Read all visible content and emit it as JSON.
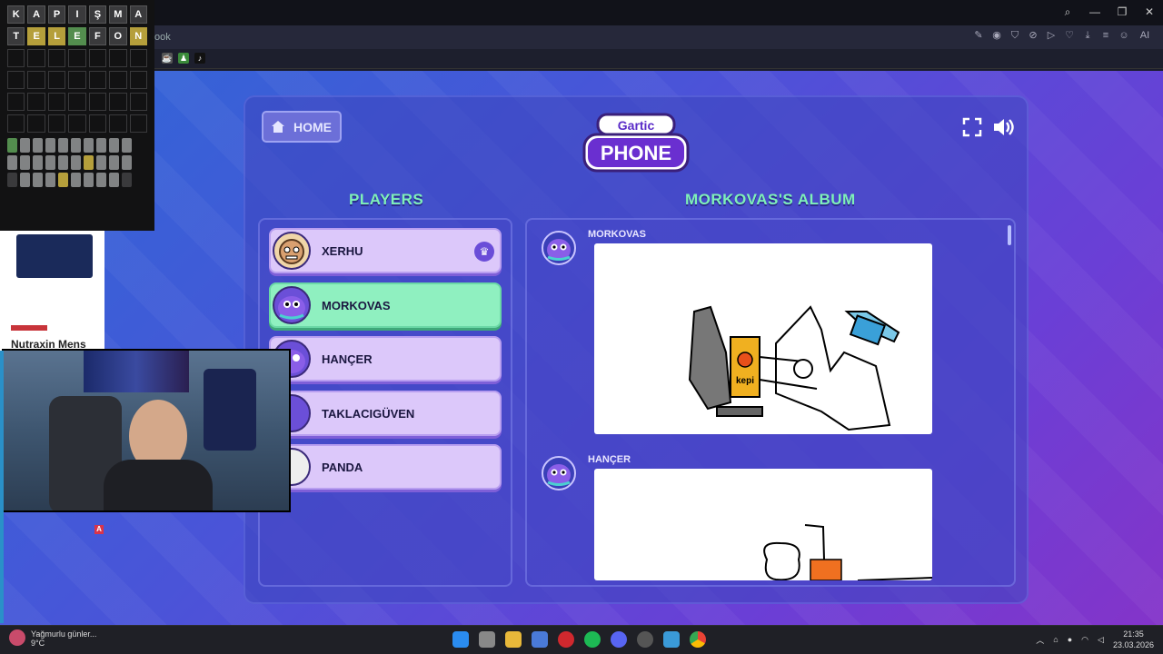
{
  "browser": {
    "address_fragment": "ook",
    "window_controls": [
      "search-icon",
      "minimize-icon",
      "restore-icon",
      "close-icon"
    ],
    "toolbar_right_label": "AI"
  },
  "game": {
    "home_label": "HOME",
    "logo_top": "Gartic",
    "logo_bottom": "PHONE",
    "players_title": "PLAYERS",
    "album_title": "MORKOVAS'S ALBUM",
    "players": [
      {
        "name": "XERHU",
        "host": true,
        "active": false
      },
      {
        "name": "MORKOVAS",
        "host": false,
        "active": true
      },
      {
        "name": "HANÇER",
        "host": false,
        "active": false
      },
      {
        "name": "TAKLACIGÜVEN",
        "host": false,
        "active": false
      },
      {
        "name": "PANDA",
        "host": false,
        "active": false
      }
    ],
    "album": [
      {
        "author": "MORKOVAS"
      },
      {
        "author": "HANÇER"
      }
    ],
    "drawing_text": "kepi",
    "colors": {
      "accent_green": "#7ff0b8",
      "player_bg": "#dcc8fa",
      "active_player_bg": "#8ff0c0"
    }
  },
  "wordle": {
    "rows": [
      [
        "K",
        "A",
        "P",
        "I",
        "Ş",
        "M",
        "A"
      ],
      [
        "T",
        "E",
        "L",
        "E",
        "F",
        "O",
        "N"
      ]
    ],
    "row2_states": [
      "filled",
      "yellow",
      "yellow",
      "green",
      "filled",
      "filled",
      "yellow"
    ]
  },
  "ad": {
    "title": "Nutraxin Mens"
  },
  "taskbar": {
    "weather_text": "Yağmurlu günler...",
    "temperature": "9°C",
    "time": "21:35",
    "date": "23.03.2026"
  }
}
